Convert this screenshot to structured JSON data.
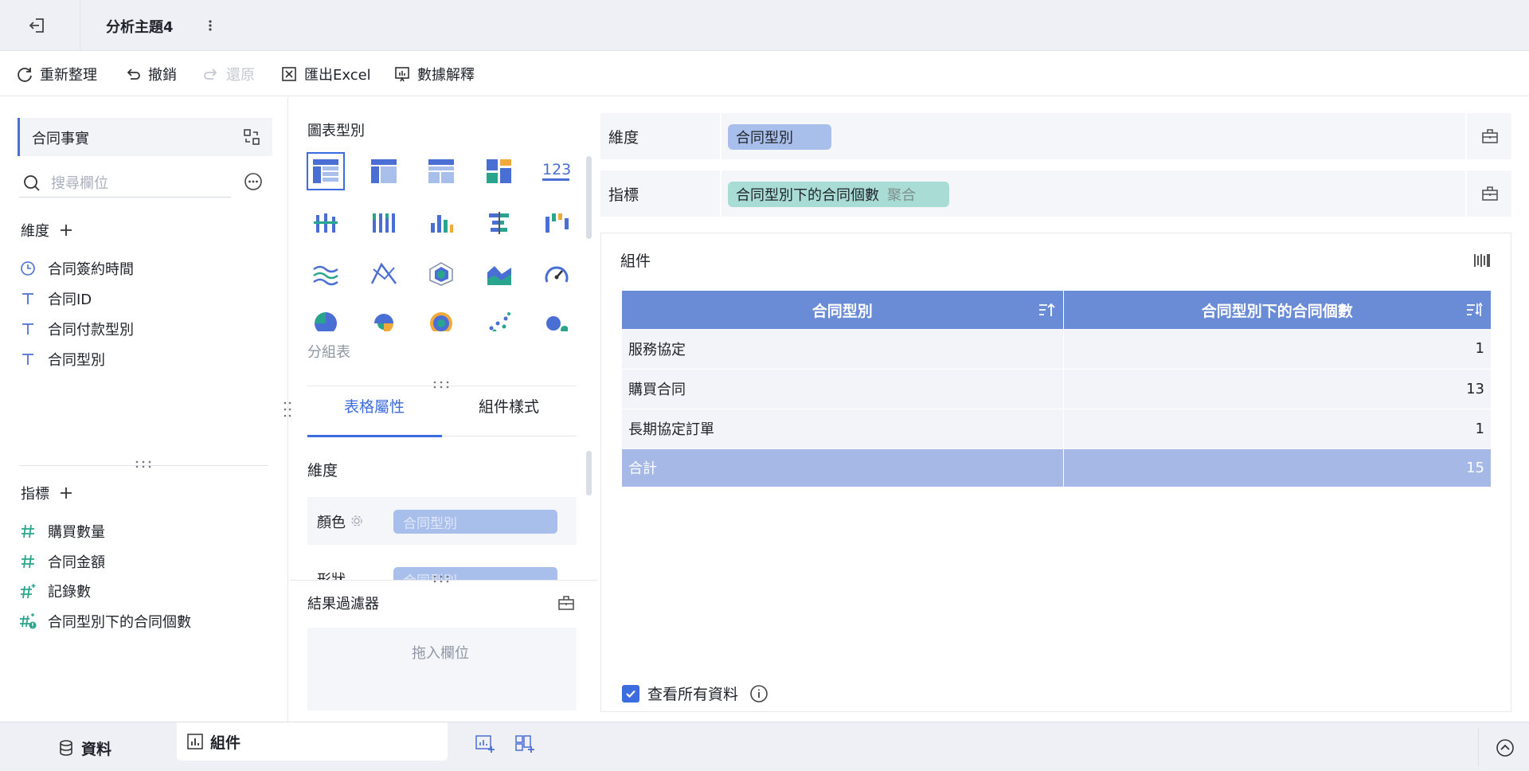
{
  "header": {
    "title": "分析主題4"
  },
  "toolbar": {
    "refresh": "重新整理",
    "undo": "撤銷",
    "redo": "還原",
    "export_excel": "匯出Excel",
    "data_explain": "數據解釋"
  },
  "left_panel": {
    "dataset_name": "合同事實",
    "search_placeholder": "搜尋欄位",
    "dimensions_title": "維度",
    "dimensions": [
      {
        "label": "合同簽約時間",
        "icon": "clock-icon"
      },
      {
        "label": "合同ID",
        "icon": "text-type-icon"
      },
      {
        "label": "合同付款型別",
        "icon": "text-type-icon"
      },
      {
        "label": "合同型別",
        "icon": "text-type-icon"
      }
    ],
    "measures_title": "指標",
    "measures": [
      {
        "label": "購買數量",
        "icon": "number-icon"
      },
      {
        "label": "合同金額",
        "icon": "number-icon"
      },
      {
        "label": "記錄數",
        "icon": "number-star-icon"
      },
      {
        "label": "合同型別下的合同個數",
        "icon": "number-calc-icon"
      }
    ]
  },
  "middle_panel": {
    "chart_type_title": "圖表型別",
    "selected_chart_name": "分組表",
    "tabs": [
      "表格屬性",
      "組件樣式"
    ],
    "active_tab": "表格屬性",
    "dimension_section_title": "維度",
    "color_label": "顏色",
    "color_value": "合同型別",
    "shape_label": "形狀",
    "shape_value": "合同型別",
    "filter_title": "結果過濾器",
    "filter_drop_hint": "拖入欄位"
  },
  "right_panel": {
    "dimension_label": "維度",
    "dimension_pill": "合同型別",
    "measure_label": "指標",
    "measure_pill": "合同型別下的合同個數",
    "measure_pill_suffix": "聚合",
    "component_title": "組件",
    "table": {
      "headers": [
        "合同型別",
        "合同型別下的合同個數"
      ],
      "rows": [
        {
          "type": "服務協定",
          "count": "1"
        },
        {
          "type": "購買合同",
          "count": "13"
        },
        {
          "type": "長期協定訂單",
          "count": "1"
        }
      ],
      "total": {
        "label": "合計",
        "count": "15"
      }
    },
    "view_all_label": "查看所有資料",
    "view_all_checked": true
  },
  "bottom_bar": {
    "data_tab": "資料",
    "component_tab": "組件"
  },
  "colors": {
    "accent": "#3d6be0",
    "header_blue": "#6a8bd6",
    "total_row": "#a5b8e6",
    "dim_pill": "#a9bfeb",
    "measure_pill": "#a8dcd4",
    "measure_icon": "#2aa58d"
  }
}
